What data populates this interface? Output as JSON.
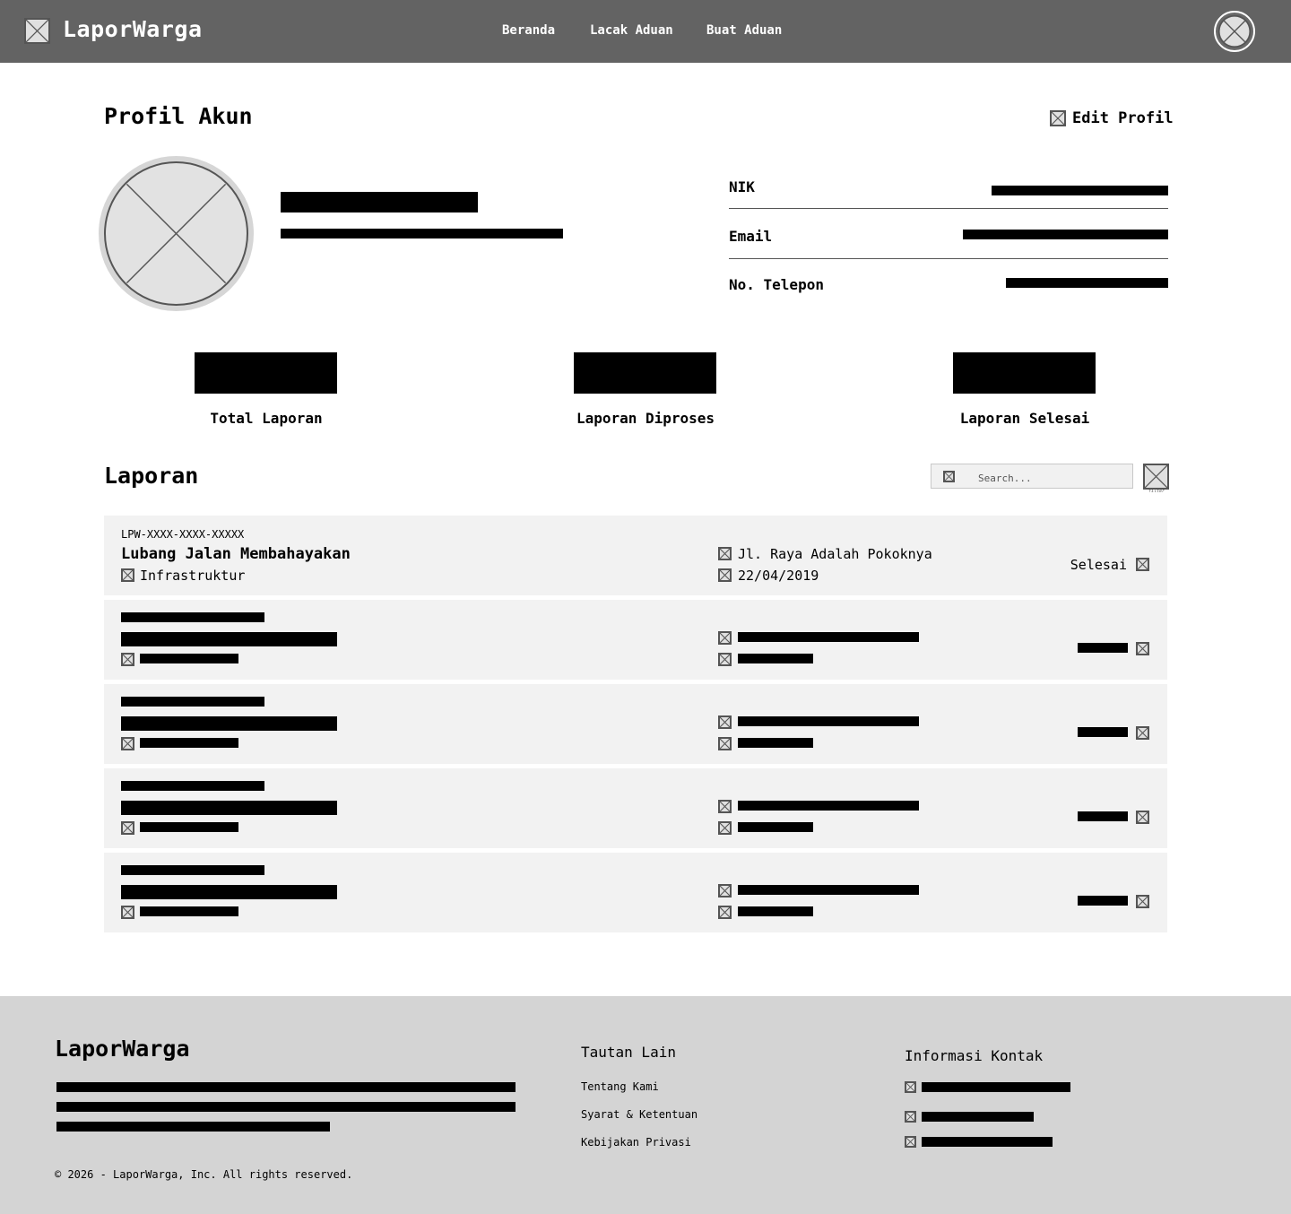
{
  "header": {
    "brand": "LaporWarga",
    "nav": [
      "Beranda",
      "Lacak Aduan",
      "Buat Aduan"
    ]
  },
  "profile": {
    "title": "Profil Akun",
    "edit_label": "Edit Profil",
    "fields": [
      "NIK",
      "Email",
      "No. Telepon"
    ]
  },
  "stats": [
    "Total Laporan",
    "Laporan Diproses",
    "Laporan Selesai"
  ],
  "reports": {
    "title": "Laporan",
    "search_placeholder": "Search...",
    "filter_caption": "filter",
    "first": {
      "id": "LPW-XXXX-XXXX-XXXXX",
      "title": "Lubang Jalan Membahayakan",
      "category": "Infrastruktur",
      "location": "Jl. Raya Adalah Pokoknya",
      "date": "22/04/2019",
      "status": "Selesai"
    }
  },
  "footer": {
    "brand": "LaporWarga",
    "links_title": "Tautan Lain",
    "links": [
      "Tentang Kami",
      "Syarat & Ketentuan",
      "Kebijakan Privasi"
    ],
    "contact_title": "Informasi Kontak",
    "copyright": "© 2026 - LaporWarga, Inc. All rights reserved."
  },
  "colors": {
    "header_bg": "#636363",
    "footer_bg": "#d4d4d4",
    "card_bg": "#f2f2f2",
    "redaction": "#000000"
  }
}
